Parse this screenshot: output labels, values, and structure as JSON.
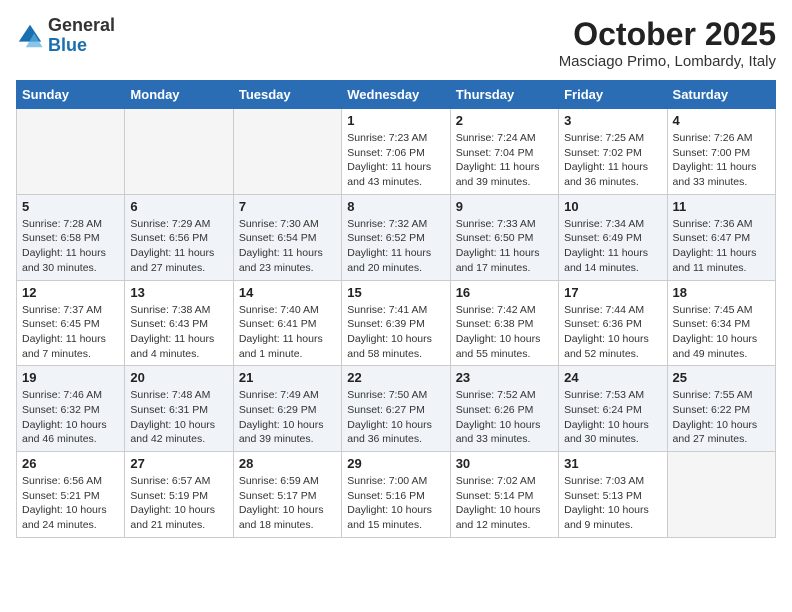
{
  "header": {
    "logo_general": "General",
    "logo_blue": "Blue",
    "month_title": "October 2025",
    "location": "Masciago Primo, Lombardy, Italy"
  },
  "weekdays": [
    "Sunday",
    "Monday",
    "Tuesday",
    "Wednesday",
    "Thursday",
    "Friday",
    "Saturday"
  ],
  "weeks": [
    [
      {
        "day": "",
        "info": ""
      },
      {
        "day": "",
        "info": ""
      },
      {
        "day": "",
        "info": ""
      },
      {
        "day": "1",
        "info": "Sunrise: 7:23 AM\nSunset: 7:06 PM\nDaylight: 11 hours\nand 43 minutes."
      },
      {
        "day": "2",
        "info": "Sunrise: 7:24 AM\nSunset: 7:04 PM\nDaylight: 11 hours\nand 39 minutes."
      },
      {
        "day": "3",
        "info": "Sunrise: 7:25 AM\nSunset: 7:02 PM\nDaylight: 11 hours\nand 36 minutes."
      },
      {
        "day": "4",
        "info": "Sunrise: 7:26 AM\nSunset: 7:00 PM\nDaylight: 11 hours\nand 33 minutes."
      }
    ],
    [
      {
        "day": "5",
        "info": "Sunrise: 7:28 AM\nSunset: 6:58 PM\nDaylight: 11 hours\nand 30 minutes."
      },
      {
        "day": "6",
        "info": "Sunrise: 7:29 AM\nSunset: 6:56 PM\nDaylight: 11 hours\nand 27 minutes."
      },
      {
        "day": "7",
        "info": "Sunrise: 7:30 AM\nSunset: 6:54 PM\nDaylight: 11 hours\nand 23 minutes."
      },
      {
        "day": "8",
        "info": "Sunrise: 7:32 AM\nSunset: 6:52 PM\nDaylight: 11 hours\nand 20 minutes."
      },
      {
        "day": "9",
        "info": "Sunrise: 7:33 AM\nSunset: 6:50 PM\nDaylight: 11 hours\nand 17 minutes."
      },
      {
        "day": "10",
        "info": "Sunrise: 7:34 AM\nSunset: 6:49 PM\nDaylight: 11 hours\nand 14 minutes."
      },
      {
        "day": "11",
        "info": "Sunrise: 7:36 AM\nSunset: 6:47 PM\nDaylight: 11 hours\nand 11 minutes."
      }
    ],
    [
      {
        "day": "12",
        "info": "Sunrise: 7:37 AM\nSunset: 6:45 PM\nDaylight: 11 hours\nand 7 minutes."
      },
      {
        "day": "13",
        "info": "Sunrise: 7:38 AM\nSunset: 6:43 PM\nDaylight: 11 hours\nand 4 minutes."
      },
      {
        "day": "14",
        "info": "Sunrise: 7:40 AM\nSunset: 6:41 PM\nDaylight: 11 hours\nand 1 minute."
      },
      {
        "day": "15",
        "info": "Sunrise: 7:41 AM\nSunset: 6:39 PM\nDaylight: 10 hours\nand 58 minutes."
      },
      {
        "day": "16",
        "info": "Sunrise: 7:42 AM\nSunset: 6:38 PM\nDaylight: 10 hours\nand 55 minutes."
      },
      {
        "day": "17",
        "info": "Sunrise: 7:44 AM\nSunset: 6:36 PM\nDaylight: 10 hours\nand 52 minutes."
      },
      {
        "day": "18",
        "info": "Sunrise: 7:45 AM\nSunset: 6:34 PM\nDaylight: 10 hours\nand 49 minutes."
      }
    ],
    [
      {
        "day": "19",
        "info": "Sunrise: 7:46 AM\nSunset: 6:32 PM\nDaylight: 10 hours\nand 46 minutes."
      },
      {
        "day": "20",
        "info": "Sunrise: 7:48 AM\nSunset: 6:31 PM\nDaylight: 10 hours\nand 42 minutes."
      },
      {
        "day": "21",
        "info": "Sunrise: 7:49 AM\nSunset: 6:29 PM\nDaylight: 10 hours\nand 39 minutes."
      },
      {
        "day": "22",
        "info": "Sunrise: 7:50 AM\nSunset: 6:27 PM\nDaylight: 10 hours\nand 36 minutes."
      },
      {
        "day": "23",
        "info": "Sunrise: 7:52 AM\nSunset: 6:26 PM\nDaylight: 10 hours\nand 33 minutes."
      },
      {
        "day": "24",
        "info": "Sunrise: 7:53 AM\nSunset: 6:24 PM\nDaylight: 10 hours\nand 30 minutes."
      },
      {
        "day": "25",
        "info": "Sunrise: 7:55 AM\nSunset: 6:22 PM\nDaylight: 10 hours\nand 27 minutes."
      }
    ],
    [
      {
        "day": "26",
        "info": "Sunrise: 6:56 AM\nSunset: 5:21 PM\nDaylight: 10 hours\nand 24 minutes."
      },
      {
        "day": "27",
        "info": "Sunrise: 6:57 AM\nSunset: 5:19 PM\nDaylight: 10 hours\nand 21 minutes."
      },
      {
        "day": "28",
        "info": "Sunrise: 6:59 AM\nSunset: 5:17 PM\nDaylight: 10 hours\nand 18 minutes."
      },
      {
        "day": "29",
        "info": "Sunrise: 7:00 AM\nSunset: 5:16 PM\nDaylight: 10 hours\nand 15 minutes."
      },
      {
        "day": "30",
        "info": "Sunrise: 7:02 AM\nSunset: 5:14 PM\nDaylight: 10 hours\nand 12 minutes."
      },
      {
        "day": "31",
        "info": "Sunrise: 7:03 AM\nSunset: 5:13 PM\nDaylight: 10 hours\nand 9 minutes."
      },
      {
        "day": "",
        "info": ""
      }
    ]
  ]
}
